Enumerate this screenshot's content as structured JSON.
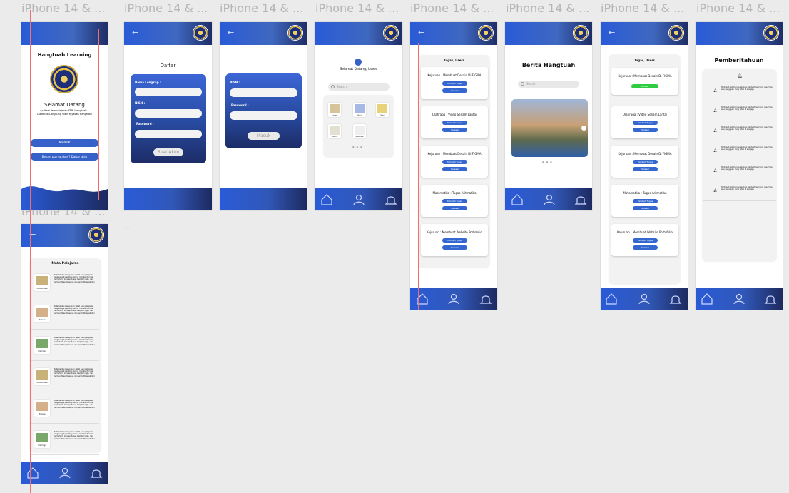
{
  "frame_label": "iPhone 14 & ...",
  "canvas_dots": "...",
  "login": {
    "title": "Hangtuah Learning",
    "welcome": "Selamat Datang",
    "subtitle": "Aplikasi Pembelajaran SMK Hangtuah 1 Dibebtuk Langsung Oleh Yayasan Hangtuah",
    "login_button": "Masuk",
    "register_button": "Belum punya akun? Daftar dulu"
  },
  "register": {
    "title": "Daftar",
    "field_name": "Nama Lengkap :",
    "field_nisn": "NISN :",
    "field_password": "Password :",
    "submit": "Buat Akun"
  },
  "signin": {
    "field_nisn": "NISN :",
    "field_password": "Password :",
    "submit": "Masuk"
  },
  "home": {
    "greeting": "Selamat Datang, Users",
    "search_placeholder": "Search",
    "subjects": [
      "Literasi",
      "Bigrit",
      "Nyari",
      "Bahtr",
      "Video Karel"
    ],
    "dots": "● ● ●"
  },
  "tasks": {
    "title": "Tugas, Users",
    "items": [
      {
        "title": "Kejuruan : Membuat Desain Di FIGMA"
      },
      {
        "title": "Olahraga : Video Senam Lantai"
      },
      {
        "title": "Kejuruan : Membuat Desain Di FIGMA"
      },
      {
        "title": "Matematika : Tugas Aritmatika"
      },
      {
        "title": "Kejuruan : Membuat Website Portofolio"
      }
    ],
    "add_label": "Tambah Tugas",
    "submit_label": "Selesai"
  },
  "news": {
    "title": "Berita Hangtuah",
    "search_placeholder": "Search",
    "dots": "● ● ●"
  },
  "tasks_done": {
    "title": "Tugas, Users",
    "done_label": "Selesai"
  },
  "notif": {
    "title": "Pemberitahuan",
    "items": [
      "Terdapat pembaruan aplikasi hantuah learning, mauf jika ada gangguan yang tidak di sengaja",
      "Terdapat pembaruan aplikasi hantuah learning, mauf jika ada gangguan yang tidak di sengaja",
      "Terdapat pembaruan aplikasi hantuah learning, mauf jika ada gangguan yang tidak di sengaja",
      "Terdapat pembaruan aplikasi hantuah learning, mauf jika ada gangguan yang tidak di sengaja",
      "Terdapat pembaruan aplikasi hantuah learning, mauf jika ada gangguan yang tidak di sengaja",
      "Terdapat pembaruan aplikasi hantuah learning, mauf jika ada gangguan yang tidak di sengaja"
    ]
  },
  "subjects": {
    "title": "Mata Pelajaran",
    "description": "Matematika merupakan salah satu pelajaran yang sangat penting karena membantu kita memahami konsep dasar, berpikir logis, dan memecahkan masalah dengan teliti sejak dini",
    "items": [
      "Matematika",
      "Bahasa",
      "Olahraga",
      "Matematika",
      "Bahasa",
      "Olahraga"
    ]
  },
  "colors": {
    "primary": "#2a5bd7",
    "dark": "#1d2a60",
    "success": "#2ecc40",
    "guide": "#f07070"
  }
}
